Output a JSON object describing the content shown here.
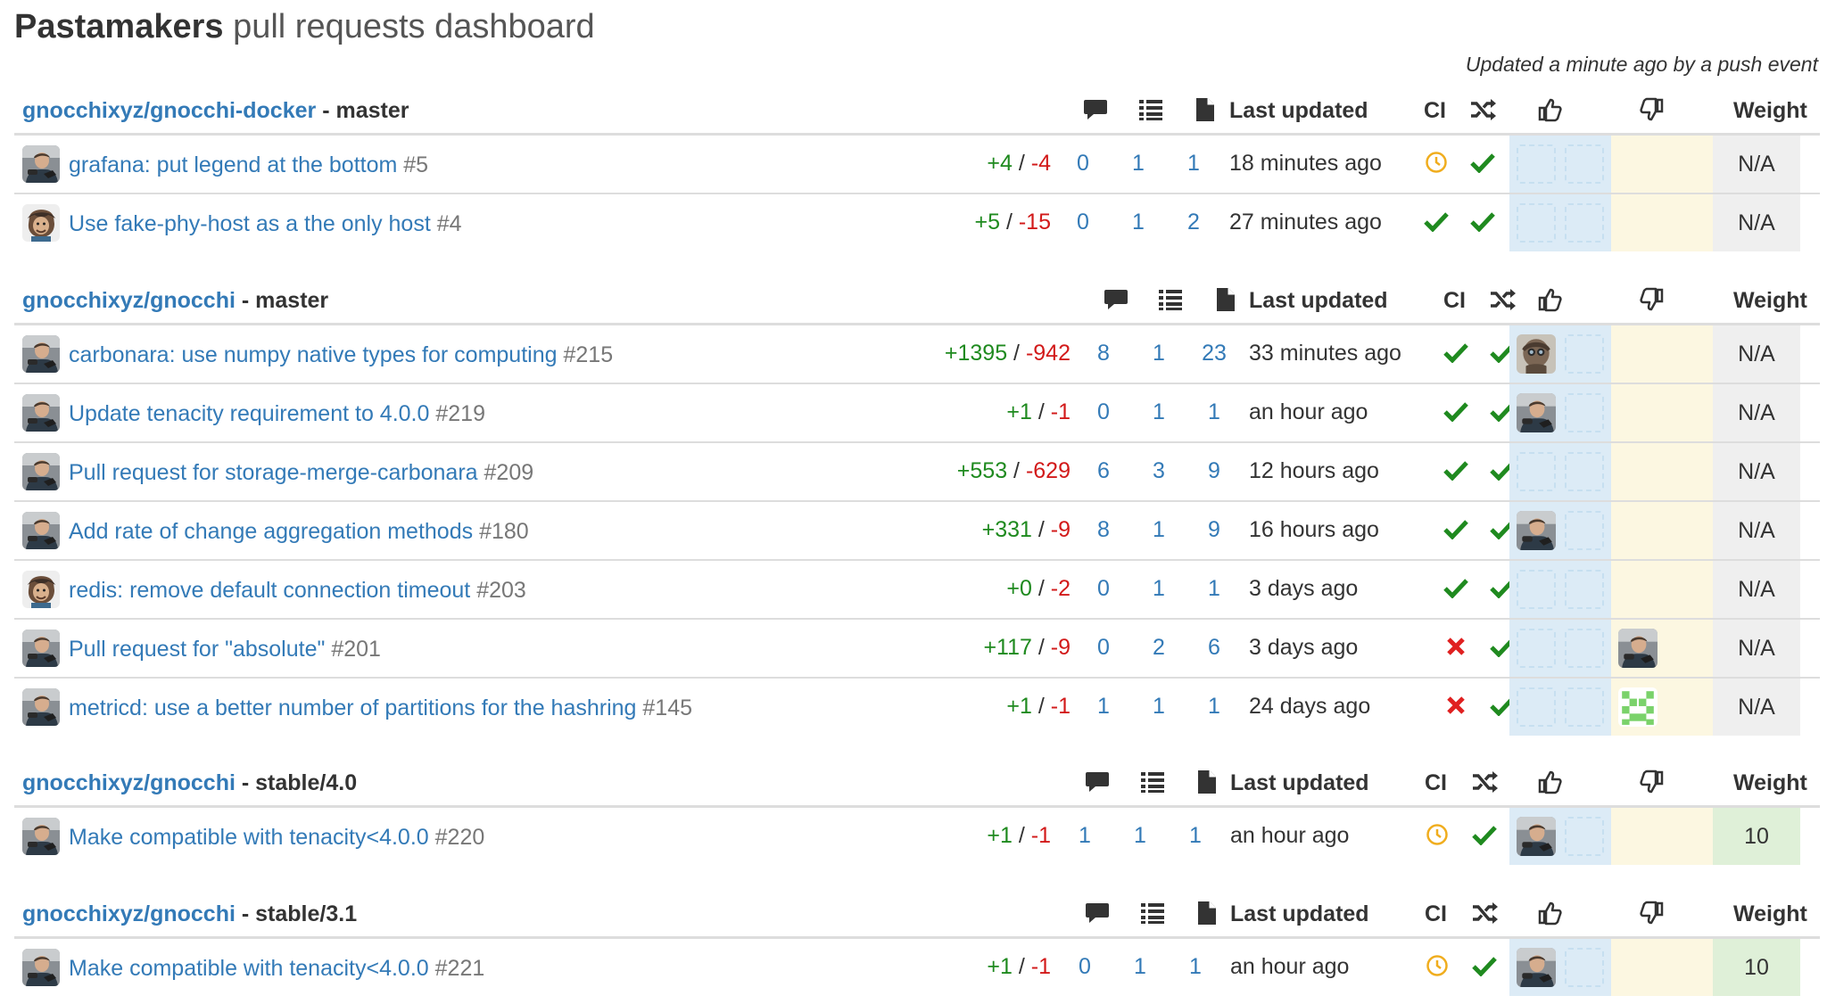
{
  "header": {
    "brand": "Pastamakers",
    "subtitle": "pull requests dashboard",
    "updated_note": "Updated a minute ago by a push event"
  },
  "columns": {
    "comments_icon": "comment-icon",
    "commits_icon": "list-icon",
    "files_icon": "file-icon",
    "last_updated": "Last updated",
    "ci": "CI",
    "merge_icon": "shuffle-icon",
    "approve_icon": "thumbs-up-icon",
    "reject_icon": "thumbs-down-icon",
    "weight": "Weight"
  },
  "colors": {
    "link": "#337ab7",
    "additions": "#1f8a1f",
    "deletions": "#d21a1a",
    "check": "#1f8a1f",
    "fail": "#e02020",
    "pending": "#f0ad1e",
    "approvals_bg": "#dcebf6",
    "changes_bg": "#fcf7e1",
    "weight_bg": "#efefef",
    "weight_good_bg": "#dff0d8"
  },
  "sections": [
    {
      "repo": "gnocchixyz/gnocchi-docker",
      "branch": "master",
      "pulls": [
        {
          "title": "grafana: put legend at the bottom",
          "number": "#5",
          "additions": "+4",
          "deletions": "-4",
          "comments": "0",
          "commits": "1",
          "files": "1",
          "updated": "18 minutes ago",
          "ci": "pending",
          "mergeable": "check",
          "approvers": [],
          "rejecters": [],
          "weight": "N/A"
        },
        {
          "title": "Use fake-phy-host as a the only host",
          "number": "#4",
          "additions": "+5",
          "deletions": "-15",
          "comments": "0",
          "commits": "1",
          "files": "2",
          "updated": "27 minutes ago",
          "ci": "check",
          "mergeable": "check",
          "approvers": [],
          "rejecters": [],
          "weight": "N/A"
        }
      ]
    },
    {
      "repo": "gnocchixyz/gnocchi",
      "branch": "master",
      "pulls": [
        {
          "title": "carbonara: use numpy native types for computing",
          "number": "#215",
          "additions": "+1395",
          "deletions": "-942",
          "comments": "8",
          "commits": "1",
          "files": "23",
          "updated": "33 minutes ago",
          "ci": "check",
          "mergeable": "check",
          "approvers": [
            "b"
          ],
          "rejecters": [],
          "weight": "N/A"
        },
        {
          "title": "Update tenacity requirement to 4.0.0",
          "number": "#219",
          "additions": "+1",
          "deletions": "-1",
          "comments": "0",
          "commits": "1",
          "files": "1",
          "updated": "an hour ago",
          "ci": "check",
          "mergeable": "check",
          "approvers": [
            "a"
          ],
          "rejecters": [],
          "weight": "N/A"
        },
        {
          "title": "Pull request for storage-merge-carbonara",
          "number": "#209",
          "additions": "+553",
          "deletions": "-629",
          "comments": "6",
          "commits": "3",
          "files": "9",
          "updated": "12 hours ago",
          "ci": "check",
          "mergeable": "check",
          "approvers": [],
          "rejecters": [],
          "weight": "N/A"
        },
        {
          "title": "Add rate of change aggregation methods",
          "number": "#180",
          "additions": "+331",
          "deletions": "-9",
          "comments": "8",
          "commits": "1",
          "files": "9",
          "updated": "16 hours ago",
          "ci": "check",
          "mergeable": "check",
          "approvers": [
            "a"
          ],
          "rejecters": [],
          "weight": "N/A"
        },
        {
          "title": "redis: remove default connection timeout",
          "number": "#203",
          "additions": "+0",
          "deletions": "-2",
          "comments": "0",
          "commits": "1",
          "files": "1",
          "updated": "3 days ago",
          "ci": "check",
          "mergeable": "check",
          "approvers": [],
          "rejecters": [],
          "weight": "N/A"
        },
        {
          "title": "Pull request for \"absolute\"",
          "number": "#201",
          "additions": "+117",
          "deletions": "-9",
          "comments": "0",
          "commits": "2",
          "files": "6",
          "updated": "3 days ago",
          "ci": "fail",
          "mergeable": "check",
          "approvers": [],
          "rejecters": [
            "a"
          ],
          "weight": "N/A"
        },
        {
          "title": "metricd: use a better number of partitions for the hashring",
          "number": "#145",
          "additions": "+1",
          "deletions": "-1",
          "comments": "1",
          "commits": "1",
          "files": "1",
          "updated": "24 days ago",
          "ci": "fail",
          "mergeable": "check",
          "approvers": [],
          "rejecters": [
            "c"
          ],
          "weight": "N/A"
        }
      ]
    },
    {
      "repo": "gnocchixyz/gnocchi",
      "branch": "stable/4.0",
      "pulls": [
        {
          "title": "Make compatible with tenacity<4.0.0",
          "number": "#220",
          "additions": "+1",
          "deletions": "-1",
          "comments": "1",
          "commits": "1",
          "files": "1",
          "updated": "an hour ago",
          "ci": "pending",
          "mergeable": "check",
          "approvers": [
            "a"
          ],
          "rejecters": [],
          "weight": "10"
        }
      ]
    },
    {
      "repo": "gnocchixyz/gnocchi",
      "branch": "stable/3.1",
      "pulls": [
        {
          "title": "Make compatible with tenacity<4.0.0",
          "number": "#221",
          "additions": "+1",
          "deletions": "-1",
          "comments": "0",
          "commits": "1",
          "files": "1",
          "updated": "an hour ago",
          "ci": "pending",
          "mergeable": "check",
          "approvers": [
            "a"
          ],
          "rejecters": [],
          "weight": "10"
        }
      ]
    }
  ]
}
